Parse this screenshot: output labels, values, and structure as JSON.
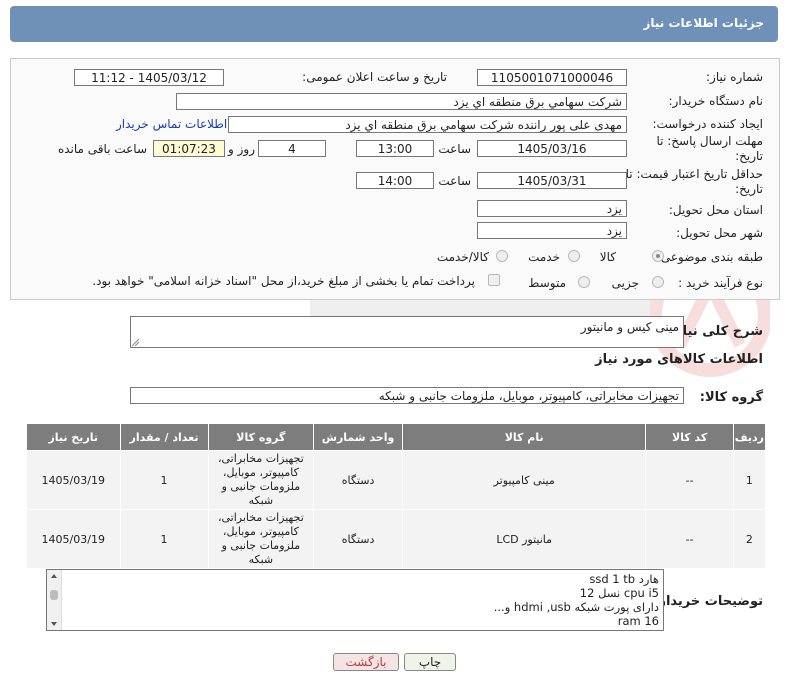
{
  "header": {
    "title": "جزئیات اطلاعات نیاز"
  },
  "form": {
    "need_number_label": "شماره نیاز:",
    "need_number": "1105001071000046",
    "announce_label": "تاریخ و ساعت اعلان عمومی:",
    "announce_value": "1405/03/12 - 11:12",
    "buyer_org_label": "نام دستگاه خریدار:",
    "buyer_org": "شرکت سهامي برق منطقه اي يزد",
    "creator_label": "ایجاد کننده درخواست:",
    "creator": "مهدی علی پور راننده شرکت سهامي برق منطقه اي يزد",
    "contact_link": "اطلاعات تماس خریدار",
    "reply_deadline_label": "مهلت ارسال پاسخ: تا تاریخ:",
    "reply_date": "1405/03/16",
    "time_label": "ساعت",
    "reply_time": "13:00",
    "days_value": "4",
    "days_label": "روز و",
    "remaining_value": "01:07:23",
    "remaining_label": "ساعت باقی مانده",
    "validity_label": "حداقل تاریخ اعتبار قیمت: تا تاریخ:",
    "validity_date": "1405/03/31",
    "validity_time": "14:00",
    "province_label": "استان محل تحویل:",
    "province": "یزد",
    "city_label": "شهر محل تحویل:",
    "city": "یزد",
    "category_label": "طبقه بندی موضوعی:",
    "cat_goods": "کالا",
    "cat_service": "خدمت",
    "cat_goods_service": "کالا/خدمت",
    "process_label": "نوع فرآیند خرید :",
    "proc_partial": "جزیی",
    "proc_medium": "متوسط",
    "payment_note": "پرداخت تمام یا بخشی از مبلغ خرید،از محل \"اسناد خزانه اسلامی\" خواهد بود."
  },
  "summary": {
    "label": "شرح کلی نیاز:",
    "value": "مینی کیس و مانیتور"
  },
  "goods_info_title": "اطلاعات کالاهای مورد نیاز",
  "goods_group": {
    "label": "گروه کالا:",
    "value": "تجهیزات مخابراتی، کامپیوتر، موبایل، ملزومات جانبی و شبکه"
  },
  "table": {
    "headers": [
      "ردیف",
      "کد کالا",
      "نام کالا",
      "واحد شمارش",
      "گروه کالا",
      "تعداد / مقدار",
      "تاریخ نیاز"
    ],
    "rows": [
      {
        "idx": "1",
        "code": "--",
        "name": "مینی کامپیوتر",
        "unit": "دستگاه",
        "group": "تجهیزات مخابراتی، کامپیوتر، موبایل، ملزومات جانبی و شبکه",
        "qty": "1",
        "date": "1405/03/19"
      },
      {
        "idx": "2",
        "code": "--",
        "name": "مانیتور LCD",
        "unit": "دستگاه",
        "group": "تجهیزات مخابراتی، کامپیوتر، موبایل، ملزومات جانبی و شبکه",
        "qty": "1",
        "date": "1405/03/19"
      }
    ]
  },
  "buyer_notes": {
    "label": "توضیحات خریدار:",
    "lines": [
      "هارد ssd 1 tb",
      "cpu i5 نسل 12",
      "دارای پورت شبکه hdmi ,usb و...",
      "ram 16"
    ]
  },
  "buttons": {
    "print": "چاپ",
    "back": "بازگشت"
  },
  "colors": {
    "title_bar": "#6f91b8",
    "table_header": "#7d7d7d",
    "link": "#1a3fa6"
  }
}
